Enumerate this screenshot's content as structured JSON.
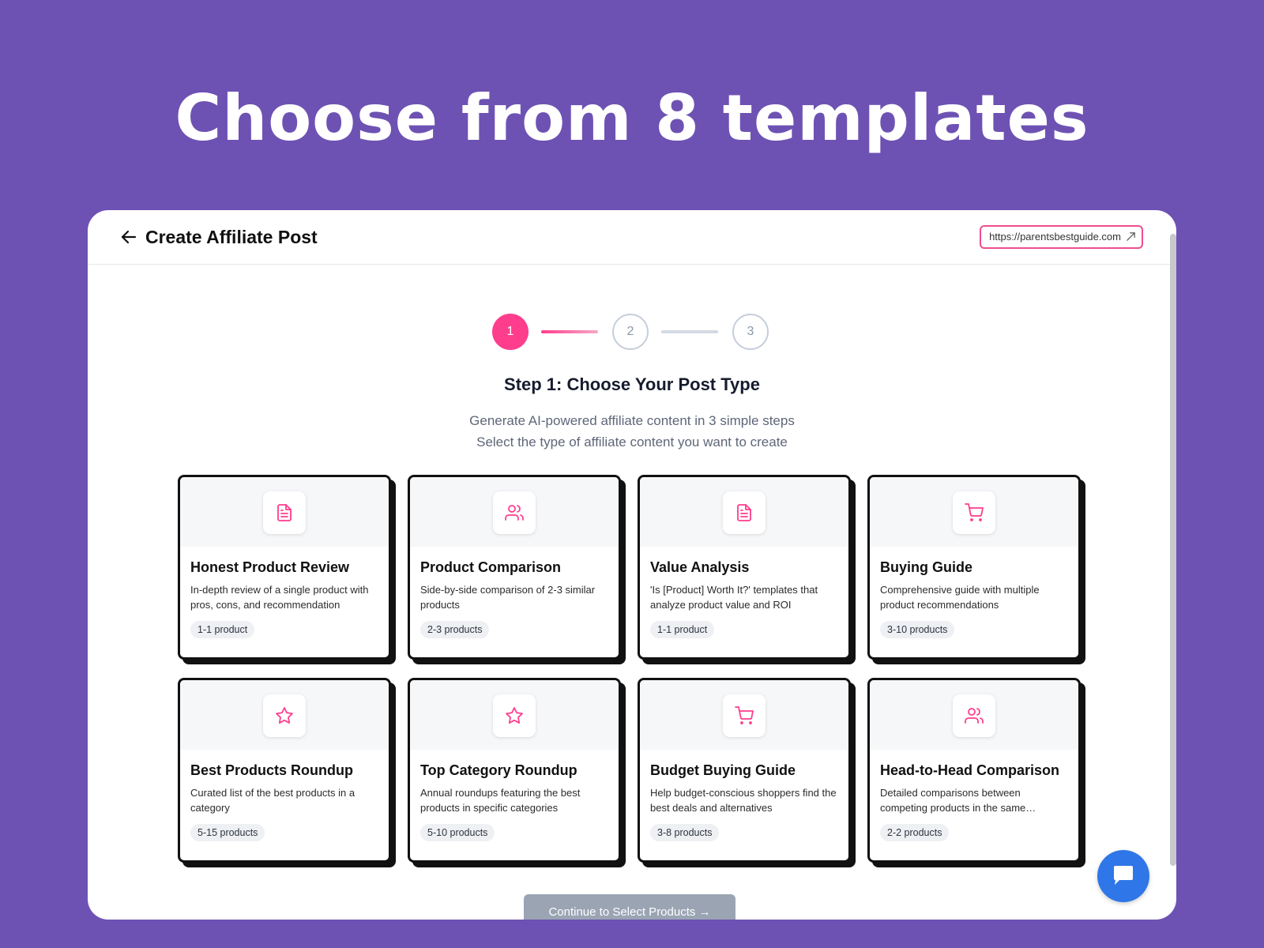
{
  "headline": "Choose from 8 templates",
  "header": {
    "title": "Create Affiliate Post",
    "url": "https://parentsbestguide.com"
  },
  "stepper": {
    "steps": [
      "1",
      "2",
      "3"
    ],
    "current": 1
  },
  "step": {
    "title": "Step 1: Choose Your Post Type",
    "subtitle_1": "Generate AI-powered affiliate content in 3 simple steps",
    "subtitle_2": "Select the type of affiliate content you want to create"
  },
  "cards": [
    {
      "icon": "document-icon",
      "title": "Honest Product Review",
      "desc": "In-depth review of a single product with pros, cons, and recommendation",
      "badge": "1-1 product"
    },
    {
      "icon": "users-icon",
      "title": "Product Comparison",
      "desc": "Side-by-side comparison of 2-3 similar products",
      "badge": "2-3 products"
    },
    {
      "icon": "document-icon",
      "title": "Value Analysis",
      "desc": "'Is [Product] Worth It?' templates that analyze product value and ROI",
      "badge": "1-1 product"
    },
    {
      "icon": "cart-icon",
      "title": "Buying Guide",
      "desc": "Comprehensive guide with multiple product recommendations",
      "badge": "3-10 products"
    },
    {
      "icon": "star-icon",
      "title": "Best Products Roundup",
      "desc": "Curated list of the best products in a category",
      "badge": "5-15 products"
    },
    {
      "icon": "star-icon",
      "title": "Top Category Roundup",
      "desc": "Annual roundups featuring the best products in specific categories",
      "badge": "5-10 products"
    },
    {
      "icon": "cart-icon",
      "title": "Budget Buying Guide",
      "desc": "Help budget-conscious shoppers find the best deals and alternatives",
      "badge": "3-8 products"
    },
    {
      "icon": "users-icon",
      "title": "Head-to-Head Comparison",
      "desc": "Detailed comparisons between competing products in the same…",
      "badge": "2-2 products"
    }
  ],
  "continue_label": "Continue to Select Products →",
  "colors": {
    "background": "#6d52b3",
    "accent": "#ff3d8d",
    "chat": "#2f77e8"
  }
}
